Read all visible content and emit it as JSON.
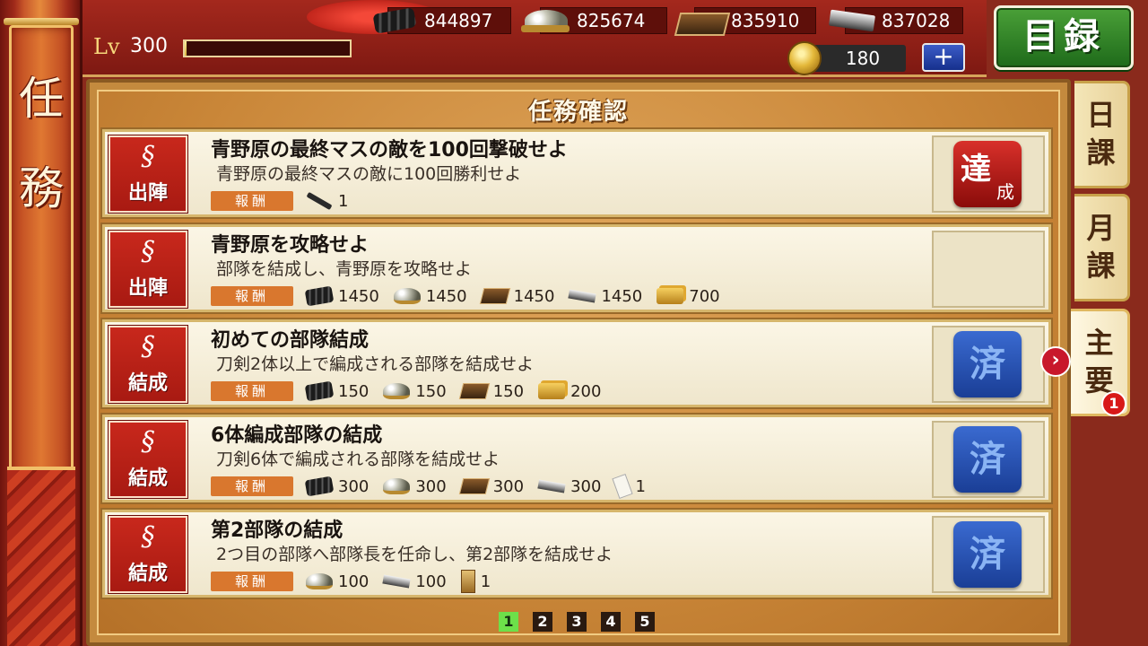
{
  "sidebar": {
    "title_line1": "任",
    "title_line2": "務"
  },
  "player": {
    "lv_label": "Lv",
    "level": "300",
    "exp_progress": 0.01
  },
  "resources": {
    "charcoal": {
      "icon": "charcoal-icon",
      "value": "844897"
    },
    "steel": {
      "icon": "steel-icon",
      "value": "825674"
    },
    "coolant": {
      "icon": "coolant-icon",
      "value": "835910"
    },
    "whetstone": {
      "icon": "whetstone-icon",
      "value": "837028"
    },
    "koban": {
      "icon": "koban-coin-icon",
      "value": "180"
    },
    "plus_label": "+"
  },
  "header": {
    "catalog_button": "目録"
  },
  "panel": {
    "title": "任務確認"
  },
  "reward_label": "報酬",
  "quests": [
    {
      "category": "出陣",
      "title": "青野原の最終マスの敵を100回撃破せよ",
      "desc": "青野原の最終マスの敵に100回勝利せよ",
      "rewards": [
        {
          "icon": "sword-icon",
          "value": "1"
        }
      ],
      "status": "achieved",
      "status_line1": "達",
      "status_line2": "成"
    },
    {
      "category": "出陣",
      "title": "青野原を攻略せよ",
      "desc": "部隊を結成し、青野原を攻略せよ",
      "rewards": [
        {
          "icon": "charcoal-icon",
          "value": "1450"
        },
        {
          "icon": "steel-icon",
          "value": "1450"
        },
        {
          "icon": "coolant-icon",
          "value": "1450"
        },
        {
          "icon": "whetstone-icon",
          "value": "1450"
        },
        {
          "icon": "koban-icon",
          "value": "700"
        }
      ],
      "status": "none"
    },
    {
      "category": "結成",
      "title": "初めての部隊結成",
      "desc": "刀剣2体以上で編成される部隊を結成せよ",
      "rewards": [
        {
          "icon": "charcoal-icon",
          "value": "150"
        },
        {
          "icon": "steel-icon",
          "value": "150"
        },
        {
          "icon": "coolant-icon",
          "value": "150"
        },
        {
          "icon": "koban-icon",
          "value": "200"
        }
      ],
      "status": "done",
      "status_label": "済"
    },
    {
      "category": "結成",
      "title": "6体編成部隊の結成",
      "desc": "刀剣6体で編成される部隊を結成せよ",
      "rewards": [
        {
          "icon": "charcoal-icon",
          "value": "300"
        },
        {
          "icon": "steel-icon",
          "value": "300"
        },
        {
          "icon": "coolant-icon",
          "value": "300"
        },
        {
          "icon": "whetstone-icon",
          "value": "300"
        },
        {
          "icon": "tag-icon",
          "value": "1"
        }
      ],
      "status": "done",
      "status_label": "済"
    },
    {
      "category": "結成",
      "title": "第2部隊の結成",
      "desc": "2つ目の部隊へ部隊長を任命し、第2部隊を結成せよ",
      "rewards": [
        {
          "icon": "steel-icon",
          "value": "100"
        },
        {
          "icon": "whetstone-icon",
          "value": "100"
        },
        {
          "icon": "plate-icon",
          "value": "1"
        }
      ],
      "status": "done",
      "status_label": "済"
    }
  ],
  "pagination": {
    "pages": [
      "1",
      "2",
      "3",
      "4",
      "5"
    ],
    "current": "1"
  },
  "side_tabs": [
    {
      "line1": "日",
      "line2": "課"
    },
    {
      "line1": "月",
      "line2": "課"
    },
    {
      "line1": "主",
      "line2": "要"
    }
  ],
  "arrow_label": "›",
  "main_tab_badge": "1"
}
